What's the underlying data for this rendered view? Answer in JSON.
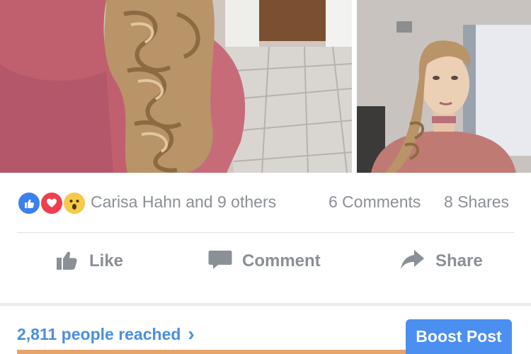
{
  "reactions": {
    "names_text": "Carisa Hahn and 9 others",
    "comments_text": "6 Comments",
    "shares_text": "8 Shares"
  },
  "actions": {
    "like_label": "Like",
    "comment_label": "Comment",
    "share_label": "Share"
  },
  "reach": {
    "text": "2,811 people reached",
    "chevron": "›"
  },
  "boost": {
    "label": "Boost Post"
  },
  "colors": {
    "accent": "#4b8ff0",
    "link": "#4a8fe0",
    "muted": "#8b8f96",
    "like_blue": "#3b80f0",
    "love_red": "#f03e4e",
    "wow_yellow": "#f7c948",
    "bar_orange": "#e7a46a"
  },
  "icons": {
    "like_reaction": "thumbs-up-icon",
    "love_reaction": "heart-icon",
    "wow_reaction": "wow-face-icon",
    "like_action": "thumbs-up-icon",
    "comment_action": "speech-bubble-icon",
    "share_action": "share-arrow-icon"
  }
}
